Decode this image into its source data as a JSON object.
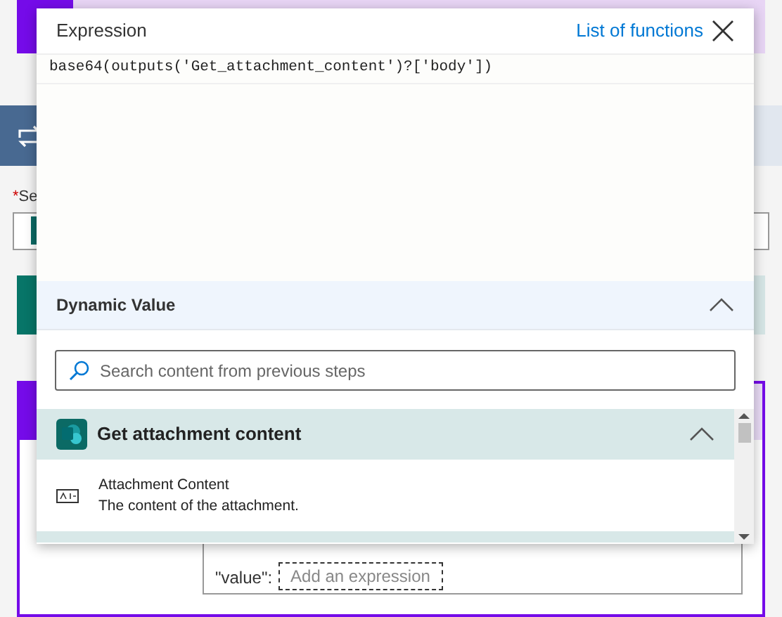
{
  "background": {
    "required_mark": "*",
    "required_label": "Se",
    "value_label": "\"value\":",
    "value_placeholder": "Add an expression"
  },
  "expression_panel": {
    "title": "Expression",
    "functions_link": "List of functions",
    "expression": "base64(outputs('Get_attachment_content')?['body'])",
    "dynamic_value": {
      "title": "Dynamic Value",
      "expanded": true,
      "search": {
        "placeholder": "Search content from previous steps"
      },
      "groups": [
        {
          "title": "Get attachment content",
          "expanded": true,
          "items": [
            {
              "title": "Attachment Content",
              "description": "The content of the attachment."
            }
          ]
        }
      ]
    }
  }
}
